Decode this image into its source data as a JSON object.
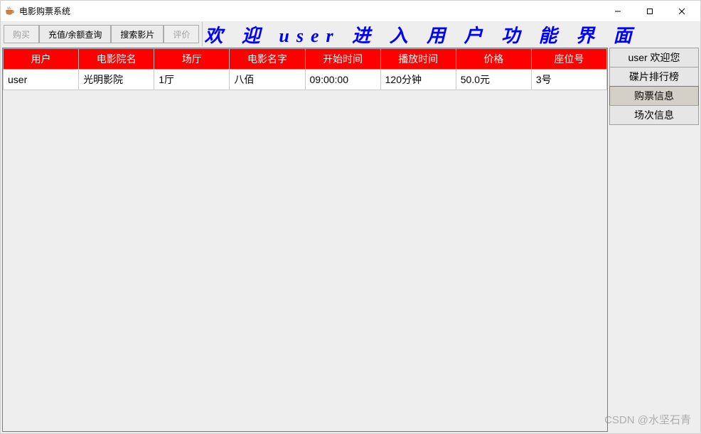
{
  "window": {
    "title": "电影购票系统"
  },
  "toolbar": {
    "buy": "购买",
    "recharge": "充值/余额查询",
    "search": "搜索影片",
    "review": "评价"
  },
  "banner": {
    "text": "欢 迎 user 进 入 用 户 功 能 界 面"
  },
  "table": {
    "headers": [
      "用户",
      "电影院名",
      "场厅",
      "电影名字",
      "开始时间",
      "播放时间",
      "价格",
      "座位号"
    ],
    "rows": [
      {
        "cells": [
          "user",
          "光明影院",
          "1厅",
          "八佰",
          "09:00:00",
          "120分钟",
          "50.0元",
          "3号"
        ]
      }
    ]
  },
  "sidebar": {
    "welcome": "user 欢迎您",
    "ranking": "碟片排行榜",
    "ticket_info": "购票信息",
    "session_info": "场次信息"
  },
  "watermark": "CSDN @水坚石青",
  "colors": {
    "header_bg": "#ff0000",
    "header_fg": "#ffffff",
    "banner_fg": "#0000ff"
  }
}
